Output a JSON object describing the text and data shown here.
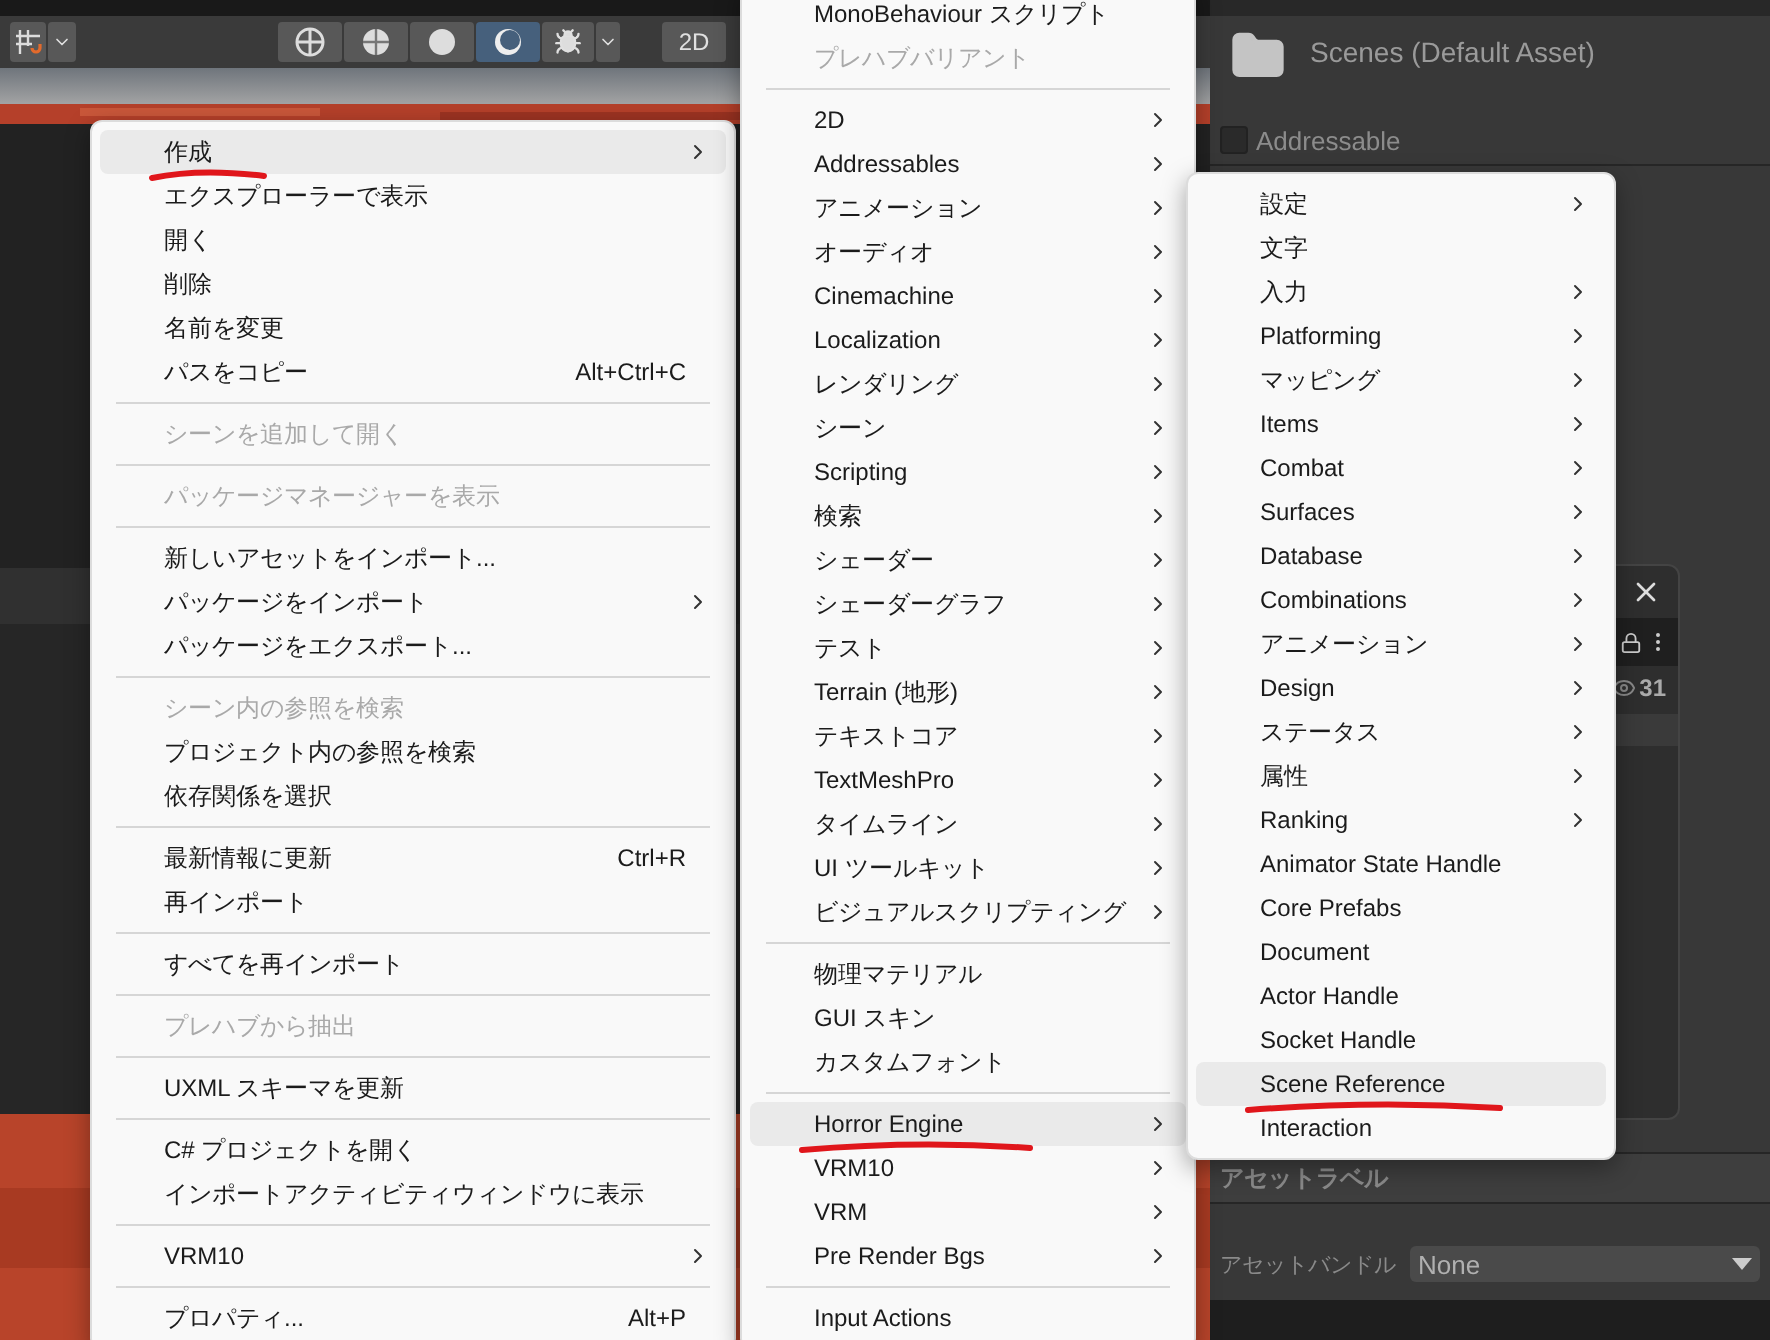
{
  "toolbar": {
    "snap_modes": [
      {
        "kind": "grid-snap"
      }
    ],
    "shading_modes": [
      {
        "kind": "wireframe",
        "selected": false
      },
      {
        "kind": "shaded-wireframe",
        "selected": false
      },
      {
        "kind": "shaded",
        "selected": false
      },
      {
        "kind": "unlit",
        "selected": true
      }
    ],
    "mode_2d": {
      "label": "2D",
      "selected": false
    }
  },
  "context_menu": {
    "items": [
      {
        "kind": "item",
        "label": "作成",
        "submenu": true,
        "highlighted": true,
        "underlined": true
      },
      {
        "kind": "item",
        "label": "エクスプローラーで表示"
      },
      {
        "kind": "item",
        "label": "開く"
      },
      {
        "kind": "item",
        "label": "削除"
      },
      {
        "kind": "item",
        "label": "名前を変更"
      },
      {
        "kind": "item",
        "label": "パスをコピー",
        "shortcut": "Alt+Ctrl+C"
      },
      {
        "kind": "separator"
      },
      {
        "kind": "item",
        "label": "シーンを追加して開く",
        "disabled": true
      },
      {
        "kind": "separator"
      },
      {
        "kind": "item",
        "label": "パッケージマネージャーを表示",
        "disabled": true
      },
      {
        "kind": "separator"
      },
      {
        "kind": "item",
        "label": "新しいアセットをインポート..."
      },
      {
        "kind": "item",
        "label": "パッケージをインポート",
        "submenu": true
      },
      {
        "kind": "item",
        "label": "パッケージをエクスポート..."
      },
      {
        "kind": "separator"
      },
      {
        "kind": "item",
        "label": "シーン内の参照を検索",
        "disabled": true
      },
      {
        "kind": "item",
        "label": "プロジェクト内の参照を検索"
      },
      {
        "kind": "item",
        "label": "依存関係を選択"
      },
      {
        "kind": "separator"
      },
      {
        "kind": "item",
        "label": "最新情報に更新",
        "shortcut": "Ctrl+R"
      },
      {
        "kind": "item",
        "label": "再インポート"
      },
      {
        "kind": "separator"
      },
      {
        "kind": "item",
        "label": "すべてを再インポート"
      },
      {
        "kind": "separator"
      },
      {
        "kind": "item",
        "label": "プレハブから抽出",
        "disabled": true
      },
      {
        "kind": "separator"
      },
      {
        "kind": "item",
        "label": "UXML スキーマを更新"
      },
      {
        "kind": "separator"
      },
      {
        "kind": "item",
        "label": "C# プロジェクトを開く"
      },
      {
        "kind": "item",
        "label": "インポートアクティビティウィンドウに表示"
      },
      {
        "kind": "separator"
      },
      {
        "kind": "item",
        "label": "VRM10",
        "submenu": true
      },
      {
        "kind": "separator"
      },
      {
        "kind": "item",
        "label": "プロパティ...",
        "shortcut": "Alt+P"
      }
    ]
  },
  "create_submenu": {
    "items": [
      {
        "kind": "item",
        "label": "MonoBehaviour スクリプト"
      },
      {
        "kind": "item",
        "label": "プレハブバリアント",
        "disabled": true
      },
      {
        "kind": "separator"
      },
      {
        "kind": "item",
        "label": "2D",
        "submenu": true
      },
      {
        "kind": "item",
        "label": "Addressables",
        "submenu": true
      },
      {
        "kind": "item",
        "label": "アニメーション",
        "submenu": true
      },
      {
        "kind": "item",
        "label": "オーディオ",
        "submenu": true
      },
      {
        "kind": "item",
        "label": "Cinemachine",
        "submenu": true
      },
      {
        "kind": "item",
        "label": "Localization",
        "submenu": true
      },
      {
        "kind": "item",
        "label": "レンダリング",
        "submenu": true
      },
      {
        "kind": "item",
        "label": "シーン",
        "submenu": true
      },
      {
        "kind": "item",
        "label": "Scripting",
        "submenu": true
      },
      {
        "kind": "item",
        "label": "検索",
        "submenu": true
      },
      {
        "kind": "item",
        "label": "シェーダー",
        "submenu": true
      },
      {
        "kind": "item",
        "label": "シェーダーグラフ",
        "submenu": true
      },
      {
        "kind": "item",
        "label": "テスト",
        "submenu": true
      },
      {
        "kind": "item",
        "label": "Terrain (地形)",
        "submenu": true
      },
      {
        "kind": "item",
        "label": "テキストコア",
        "submenu": true
      },
      {
        "kind": "item",
        "label": "TextMeshPro",
        "submenu": true
      },
      {
        "kind": "item",
        "label": "タイムライン",
        "submenu": true
      },
      {
        "kind": "item",
        "label": "UI ツールキット",
        "submenu": true
      },
      {
        "kind": "item",
        "label": "ビジュアルスクリプティング",
        "submenu": true
      },
      {
        "kind": "separator"
      },
      {
        "kind": "item",
        "label": "物理マテリアル"
      },
      {
        "kind": "item",
        "label": "GUI スキン"
      },
      {
        "kind": "item",
        "label": "カスタムフォント"
      },
      {
        "kind": "separator"
      },
      {
        "kind": "item",
        "label": "Horror Engine",
        "submenu": true,
        "highlighted": true,
        "underlined": true
      },
      {
        "kind": "item",
        "label": "VRM10",
        "submenu": true
      },
      {
        "kind": "item",
        "label": "VRM",
        "submenu": true
      },
      {
        "kind": "item",
        "label": "Pre Render Bgs",
        "submenu": true
      },
      {
        "kind": "separator"
      },
      {
        "kind": "item",
        "label": "Input Actions"
      }
    ]
  },
  "horror_engine_submenu": {
    "items": [
      {
        "kind": "item",
        "label": "設定",
        "submenu": true
      },
      {
        "kind": "item",
        "label": "文字"
      },
      {
        "kind": "item",
        "label": "入力",
        "submenu": true
      },
      {
        "kind": "item",
        "label": "Platforming",
        "submenu": true
      },
      {
        "kind": "item",
        "label": "マッピング",
        "submenu": true
      },
      {
        "kind": "item",
        "label": "Items",
        "submenu": true
      },
      {
        "kind": "item",
        "label": "Combat",
        "submenu": true
      },
      {
        "kind": "item",
        "label": "Surfaces",
        "submenu": true
      },
      {
        "kind": "item",
        "label": "Database",
        "submenu": true
      },
      {
        "kind": "item",
        "label": "Combinations",
        "submenu": true
      },
      {
        "kind": "item",
        "label": "アニメーション",
        "submenu": true
      },
      {
        "kind": "item",
        "label": "Design",
        "submenu": true
      },
      {
        "kind": "item",
        "label": "ステータス",
        "submenu": true
      },
      {
        "kind": "item",
        "label": "属性",
        "submenu": true
      },
      {
        "kind": "item",
        "label": "Ranking",
        "submenu": true
      },
      {
        "kind": "item",
        "label": "Animator State Handle"
      },
      {
        "kind": "item",
        "label": "Core Prefabs"
      },
      {
        "kind": "item",
        "label": "Document"
      },
      {
        "kind": "item",
        "label": "Actor Handle"
      },
      {
        "kind": "item",
        "label": "Socket Handle"
      },
      {
        "kind": "item",
        "label": "Scene Reference",
        "highlighted": true,
        "underlined": true
      },
      {
        "kind": "item",
        "label": "Interaction"
      }
    ]
  },
  "inspector": {
    "title": "Scenes (Default Asset)",
    "addressable": {
      "label": "Addressable",
      "checked": false
    },
    "asset_labels": {
      "heading": "アセットラベル"
    },
    "asset_bundle": {
      "label": "アセットバンドル",
      "value": "None"
    }
  },
  "floating_window": {
    "count": "31"
  }
}
